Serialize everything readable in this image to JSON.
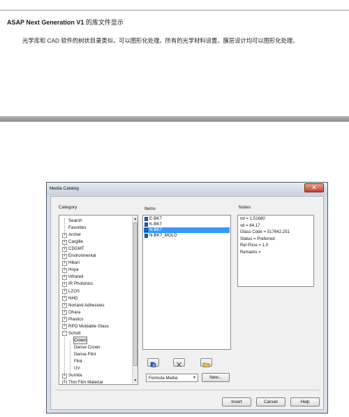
{
  "document": {
    "title_bold": "ASAP Next Generation V1",
    "title_cn": " 的库文件显示",
    "body_text": "光学库和 CAD 软件的树状目录类似，可以图形化处理。所有的光学材料设置、膜层设计均可以图形化处理。"
  },
  "dialog": {
    "title": "Media Catalog",
    "close_symbol": "✕",
    "category_label": "Category",
    "items_label": "Items",
    "notes_label": "Notes",
    "categories": [
      {
        "label": "Search",
        "expander": ""
      },
      {
        "label": "Favorites",
        "expander": ""
      },
      {
        "label": "Archer",
        "expander": "+"
      },
      {
        "label": "Cargille",
        "expander": "+"
      },
      {
        "label": "CDGMT",
        "expander": "+"
      },
      {
        "label": "Environmental",
        "expander": "+"
      },
      {
        "label": "Hikari",
        "expander": "+"
      },
      {
        "label": "Hoya",
        "expander": "+"
      },
      {
        "label": "Infrared",
        "expander": "+"
      },
      {
        "label": "IR Photonics",
        "expander": "+"
      },
      {
        "label": "LZOS",
        "expander": "+"
      },
      {
        "label": "NHG",
        "expander": "+"
      },
      {
        "label": "Norland Adhesives",
        "expander": "+"
      },
      {
        "label": "Ohara",
        "expander": "+"
      },
      {
        "label": "Plastics",
        "expander": "+"
      },
      {
        "label": "RPO Moldable Glass",
        "expander": "+"
      },
      {
        "label": "Schott",
        "expander": "−"
      },
      {
        "label": "Crown",
        "expander": ""
      },
      {
        "label": "Dense Crown",
        "expander": ""
      },
      {
        "label": "Dense Flint",
        "expander": ""
      },
      {
        "label": "Flint",
        "expander": ""
      },
      {
        "label": "UV",
        "expander": ""
      },
      {
        "label": "Sumita",
        "expander": "+"
      },
      {
        "label": "Thin Film Material",
        "expander": "+"
      }
    ],
    "selected_category": "Crown",
    "items": [
      "E-BK7",
      "K-BK7",
      "N-BK7",
      "N-BK7_MOLD"
    ],
    "selected_item": "N-BK7",
    "notes": [
      "nd = 1.51680",
      "νd = 64.17",
      "Glass Code = 517642.251",
      "Status = Preferred",
      "Rel Price = 1.0",
      "Remarks ="
    ],
    "media_type_value": "Formula Media",
    "new_button": "New...",
    "insert_button": "Insert",
    "cancel_button": "Cancel",
    "help_button": "Help"
  },
  "colors": {
    "selection": "#3399ff",
    "close_button": "#c0442c",
    "band": "#9a9a9a"
  }
}
